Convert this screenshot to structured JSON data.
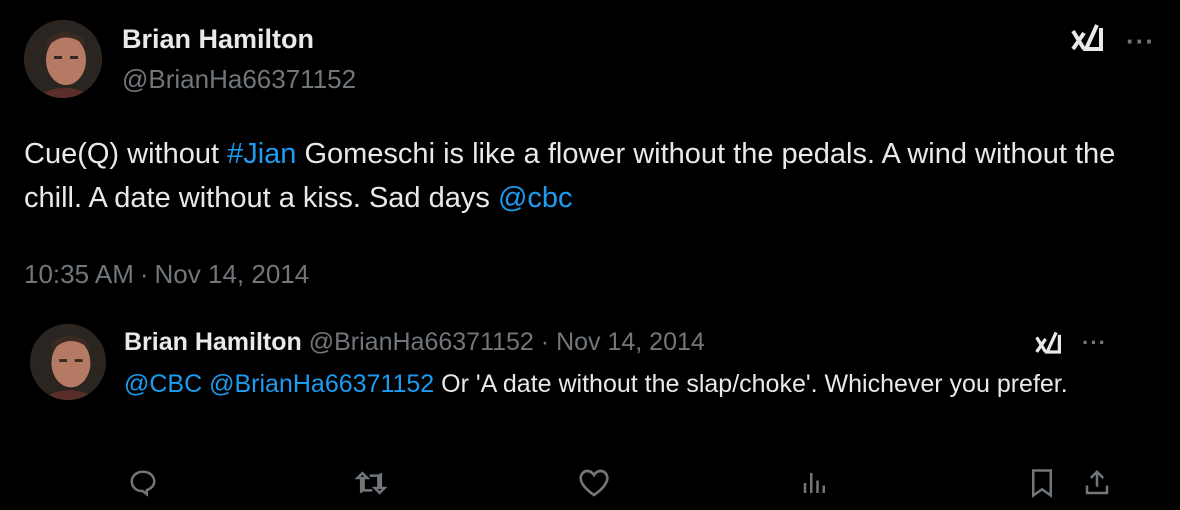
{
  "tweet": {
    "author_name": "Brian Hamilton",
    "author_handle": "@BrianHa66371152",
    "text_parts": [
      "Cue(Q) without ",
      "#Jian",
      " Gomeschi is like a flower without the pedals. A wind without the chill. A date without a kiss. Sad days ",
      "@cbc"
    ],
    "time": "10:35 AM",
    "separator": "·",
    "date": "Nov 14, 2014",
    "more_label": "···",
    "grok_icon": "grok-icon"
  },
  "reply": {
    "author_name": "Brian Hamilton",
    "author_handle": "@BrianHa66371152",
    "separator": "·",
    "date": "Nov 14, 2014",
    "mention_1": "@CBC",
    "mention_2": "@BrianHa66371152",
    "text": " Or 'A date without the slap/choke'.  Whichever you prefer.",
    "more_label": "···",
    "grok_icon": "grok-icon"
  },
  "actions": [
    "reply-icon",
    "retweet-icon",
    "like-icon",
    "views-icon",
    "bookmark-icon",
    "share-icon"
  ],
  "colors": {
    "background": "#000000",
    "text": "#e7e9ea",
    "secondary": "#71767b",
    "link": "#1d9bf0"
  }
}
